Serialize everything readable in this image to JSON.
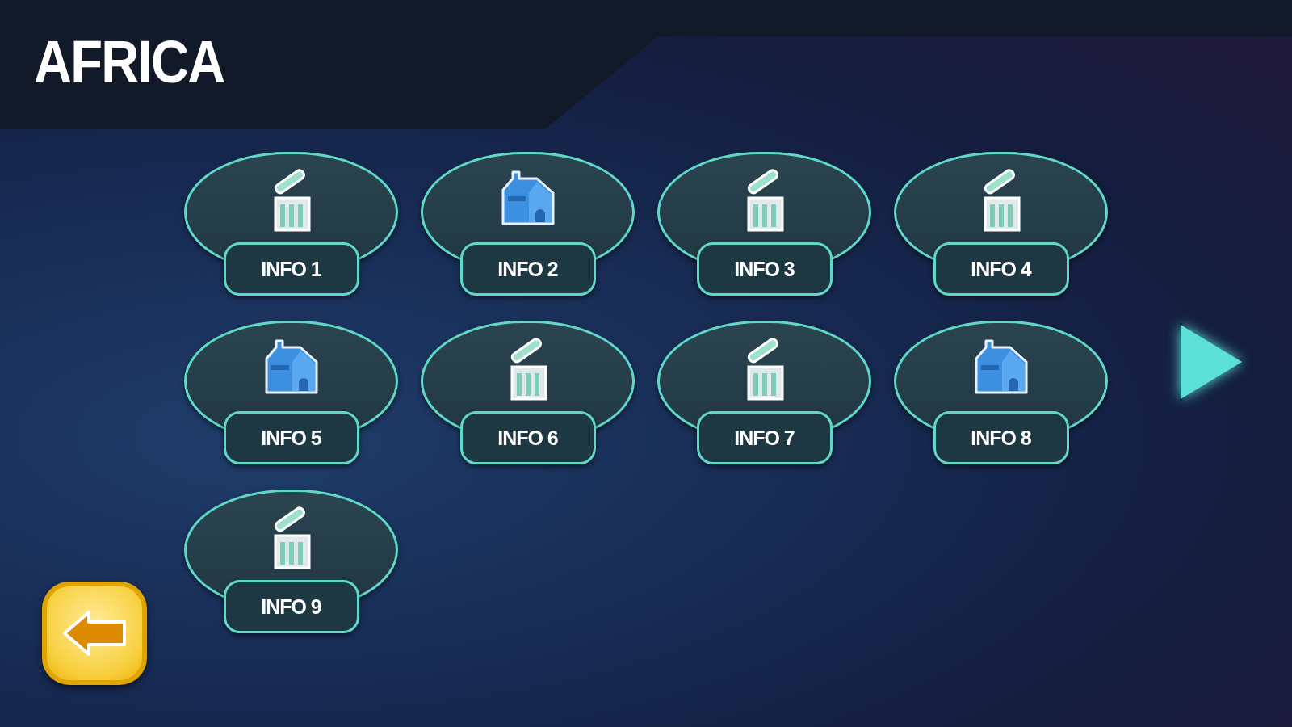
{
  "header": {
    "title": "AFRICA"
  },
  "cards": [
    {
      "label": "INFO 1",
      "kind": "trash"
    },
    {
      "label": "INFO 2",
      "kind": "house"
    },
    {
      "label": "INFO 3",
      "kind": "trash"
    },
    {
      "label": "INFO 4",
      "kind": "trash"
    },
    {
      "label": "INFO 5",
      "kind": "house"
    },
    {
      "label": "INFO 6",
      "kind": "trash"
    },
    {
      "label": "INFO 7",
      "kind": "trash"
    },
    {
      "label": "INFO 8",
      "kind": "house"
    },
    {
      "label": "INFO 9",
      "kind": "trash"
    }
  ]
}
